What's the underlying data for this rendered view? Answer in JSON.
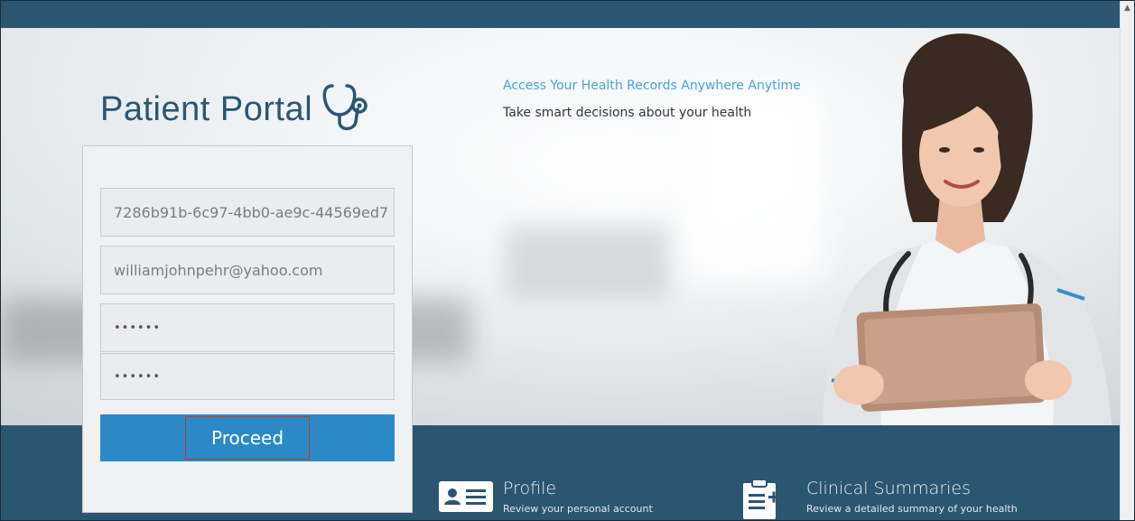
{
  "header": {
    "logo_text": "Patient Portal",
    "tagline_primary": "Access Your Health Records Anywhere Anytime",
    "tagline_secondary": "Take smart decisions about your health"
  },
  "form": {
    "fields": [
      {
        "value": "7286b91b-6c97-4bb0-ae9c-44569ed7"
      },
      {
        "value": "williamjohnpehr@yahoo.com"
      },
      {
        "value": "••••••"
      },
      {
        "value": "••••••"
      }
    ],
    "proceed_label": "Proceed"
  },
  "features": [
    {
      "title": "Profile",
      "description": "Review your personal account",
      "icon": "id-card-icon"
    },
    {
      "title": "Clinical Summaries",
      "description": "Review a detailed summary of your health",
      "icon": "clipboard-plus-icon"
    }
  ],
  "colors": {
    "brand": "#2b5672",
    "accent": "#2b8ac6",
    "tagline": "#4aa3dc",
    "highlight_border": "#c0392b"
  }
}
